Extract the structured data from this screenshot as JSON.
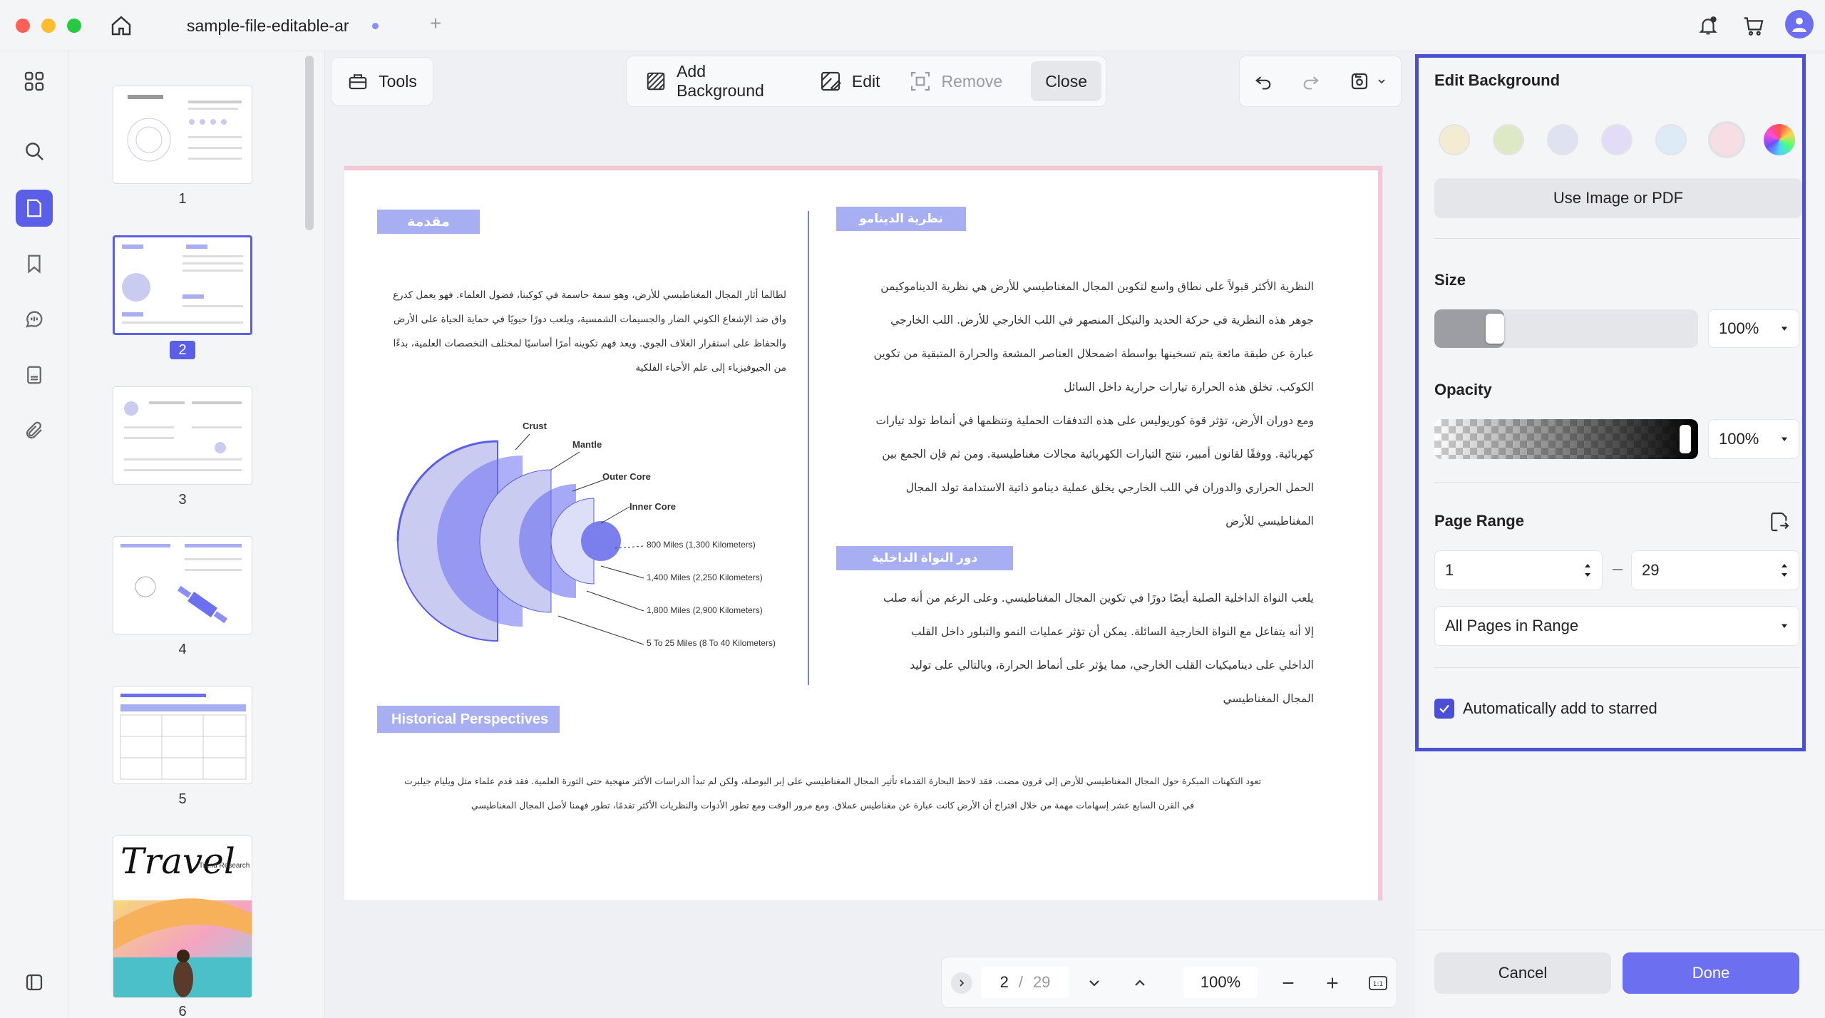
{
  "window": {
    "tab_title": "sample-file-editable-ar"
  },
  "toolbar": {
    "tools_label": "Tools",
    "add_background_label": "Add Background",
    "edit_label": "Edit",
    "remove_label": "Remove",
    "close_label": "Close"
  },
  "thumbnails": [
    {
      "number": "1"
    },
    {
      "number": "2"
    },
    {
      "number": "3"
    },
    {
      "number": "4"
    },
    {
      "number": "5"
    },
    {
      "number": "6"
    }
  ],
  "thumb6": {
    "title": "Travel",
    "subtitle": "Trend Research"
  },
  "document": {
    "heading_intro": "مقدمة",
    "heading_dynamo": "نظرية الدينامو",
    "heading_core": "دور النواة الداخلية",
    "heading_history": "Historical Perspectives",
    "intro_lines": [
      "لطالما أثار المجال المغناطيسي للأرض، وهو سمة حاسمة في كوكبنا، فضول العلماء. فهو يعمل كدرع",
      "واق ضد الإشعاع الكوني الضار والجسيمات الشمسية، ويلعب دورًا حيويًا في حماية الحياة على الأرض",
      "والحفاظ على استقرار الغلاف الجوي. ويعد فهم تكوينه أمرًا أساسيًا لمختلف التخصصات العلمية، بدءًا",
      "من الجيوفيزياء إلى علم الأحياء الفلكية"
    ],
    "dynamo_lines": [
      "النظرية الأكثر قبولاً على نطاق واسع لتكوين المجال المغناطيسي للأرض هي نظرية الديناموكيمن",
      "جوهر هذه النظرية في حركة الحديد والنيكل المنصهر في اللب الخارجي للأرض. اللب الخارجي",
      "عبارة عن طبقة مائعة يتم تسخينها بواسطة اضمحلال العناصر المشعة والحرارة المتبقية من تكوين",
      "الكوكب. تخلق هذه الحرارة تيارات حرارية داخل السائل",
      "ومع دوران الأرض، تؤثر قوة كوريوليس على هذه التدفقات الحملية وتنظمها في أنماط تولد تيارات",
      "كهربائية. ووفقًا لقانون أمبير، تنتج التيارات الكهربائية مجالات مغناطيسية. ومن ثم فإن الجمع بين",
      "الحمل الحراري والدوران في اللب الخارجي يخلق عملية دينامو ذاتية الاستدامة تولد المجال",
      "المغناطيسي للأرض"
    ],
    "core_lines": [
      "يلعب النواة الداخلية الصلبة أيضًا دورًا في تكوين المجال المغناطيسي. وعلى الرغم من أنه صلب",
      "إلا أنه يتفاعل مع النواة الخارجية السائلة. يمكن أن تؤثر عمليات النمو والتبلور داخل القلب",
      "الداخلي على ديناميكيات القلب الخارجي، مما يؤثر على أنماط الحرارة، وبالتالي على توليد",
      "المجال المغناطيسي"
    ],
    "history_lines": [
      "تعود التكهنات المبكرة حول المجال المغناطيسي للأرض إلى قرون مضت. فقد لاحظ البحارة القدماء تأثير المجال المغناطيسي على إبر البوصلة، ولكن لم تبدأ الدراسات الأكثر منهجية حتى الثورة العلمية. فقد قدم علماء مثل ويليام جيلبرت",
      "في القرن السابع عشر إسهامات مهمة من خلال اقتراح أن الأرض كانت عبارة عن مغناطيس عملاق. ومع مرور الوقت ومع تطور الأدوات والنظريات الأكثر تقدمًا، تطور فهمنا لأصل المجال المغناطيسي"
    ],
    "diagram": {
      "crust": "Crust",
      "mantle": "Mantle",
      "outer_core": "Outer Core",
      "inner_core": "Inner Core",
      "m1": "800 Miles (1,300 Kilometers)",
      "m2": "1,400 Miles (2,250 Kilometers)",
      "m3": "1,800 Miles (2,900 Kilometers)",
      "m4": "5 To 25 Miles (8 To 40 Kilometers)"
    }
  },
  "panel": {
    "title": "Edit Background",
    "swatches": [
      "#f3ecd2",
      "#dce9c4",
      "#dfe2f0",
      "#e3dcf6",
      "#dcebf6",
      "#f7dde4"
    ],
    "use_image_label": "Use Image or PDF",
    "size_label": "Size",
    "size_value": "100%",
    "opacity_label": "Opacity",
    "opacity_value": "100%",
    "page_range_label": "Page Range",
    "range_from": "1",
    "range_to": "29",
    "range_mode": "All Pages in Range",
    "auto_star_label": "Automatically add to starred",
    "cancel_label": "Cancel",
    "done_label": "Done"
  },
  "pager": {
    "current": "2",
    "separator": "/",
    "total": "29",
    "zoom": "100%"
  }
}
